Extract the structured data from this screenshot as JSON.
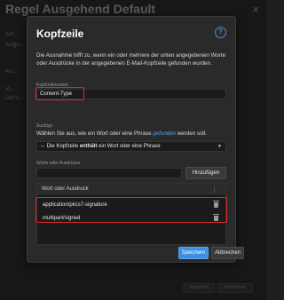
{
  "background": {
    "title": "Regel Ausgehend Default",
    "close": "×",
    "lines": [
      "Auf ...",
      "Aufge...",
      "Au...",
      "Vi...",
      "Det V..."
    ],
    "button_save": "Speichern",
    "button_cancel": "Abbrechen"
  },
  "dialog": {
    "title": "Kopfzeile",
    "help": "?",
    "description": "Die Ausnahme trifft zu, wenn ein oder mehrere der unten angegebenen Worte oder Ausdrücke in der angegebenen E-Mail-Kopfzeile gefunden wurden.",
    "header_name_label": "Kopfzeilenname",
    "header_name_value": "Content-Type",
    "search_type_label": "Suchtyp",
    "search_hint_prefix": "Wählen Sie aus, wie ein Wort oder eine Phrase",
    "search_hint_link": "gefunden",
    "search_hint_suffix": "werden soll.",
    "search_type_value_pre": "Die Kopfzeile",
    "search_type_value_bold": "enthält",
    "search_type_value_post": "ein Wort oder eine Phrase",
    "words_label": "Worte oder Ausdrücke",
    "add_button": "Hinzufügen",
    "table_header": "Wort oder Ausdruck",
    "rows": [
      {
        "value": "application/pkcs7-signature"
      },
      {
        "value": "multipart/signed"
      }
    ],
    "save_button": "Speichern",
    "cancel_button": "Abbrechen"
  },
  "colors": {
    "accent": "#3d8fe0",
    "highlight": "#e02828",
    "link": "#4aa3ff"
  }
}
